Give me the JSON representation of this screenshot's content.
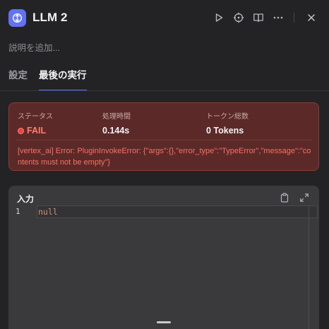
{
  "header": {
    "title": "LLM 2",
    "icons": [
      "llm-node-icon",
      "play-icon",
      "crosshair-icon",
      "book-icon",
      "more-icon",
      "close-icon"
    ]
  },
  "description_placeholder": "説明を追加...",
  "tabs": [
    {
      "label": "設定",
      "active": false
    },
    {
      "label": "最後の実行",
      "active": true
    }
  ],
  "result": {
    "status_label": "ステータス",
    "status_value": "FAIL",
    "time_label": "処理時間",
    "time_value": "0.144s",
    "tokens_label": "トークン総数",
    "tokens_value": "0 Tokens",
    "error_message": "[vertex_ai] Error: PluginInvokeError: {\"args\":{},\"error_type\":\"TypeError\",\"message\":\"contents must not be empty\"}"
  },
  "input": {
    "title": "入力",
    "line_number": "1",
    "code": "null"
  },
  "colors": {
    "accent": "#4f7cf6",
    "node_icon": "#6172f3",
    "fail": "#f04438",
    "error_text": "#f97066"
  }
}
